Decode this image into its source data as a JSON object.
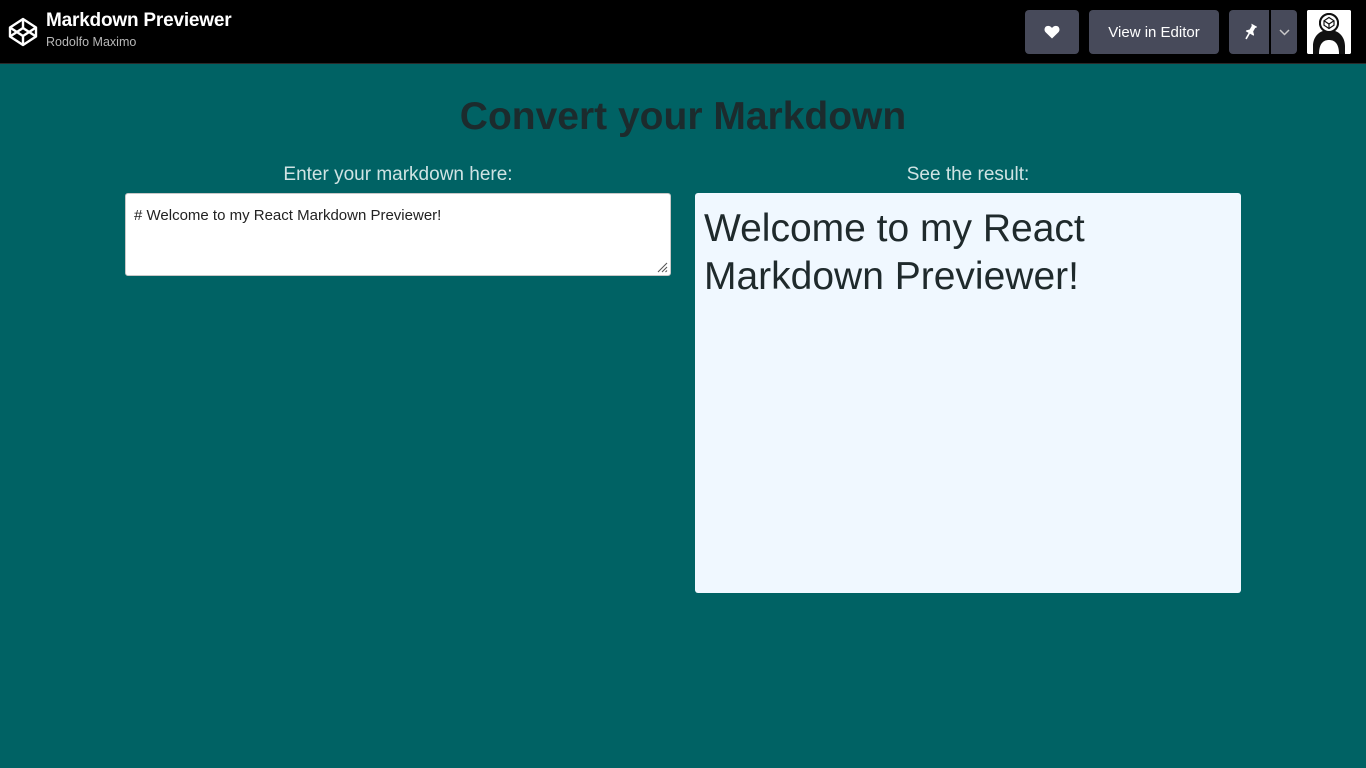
{
  "header": {
    "pen_title": "Markdown Previewer",
    "author": "Rodolfo Maximo",
    "view_in_editor_label": "View in Editor",
    "logo_icon": "codepen-logo-icon",
    "heart_icon": "heart-icon",
    "pin_icon": "pin-icon",
    "caret_icon": "chevron-down-icon"
  },
  "main": {
    "heading": "Convert your Markdown",
    "editor_label": "Enter your markdown here:",
    "preview_label": "See the result:",
    "editor_value": "# Welcome to my React Markdown Previewer!",
    "preview_h1": "Welcome to my React Markdown Previewer!"
  },
  "colors": {
    "page_bg": "#006264",
    "topbar_bg": "#000000",
    "button_bg": "#474a5a",
    "preview_bg": "#f0f8ff"
  }
}
